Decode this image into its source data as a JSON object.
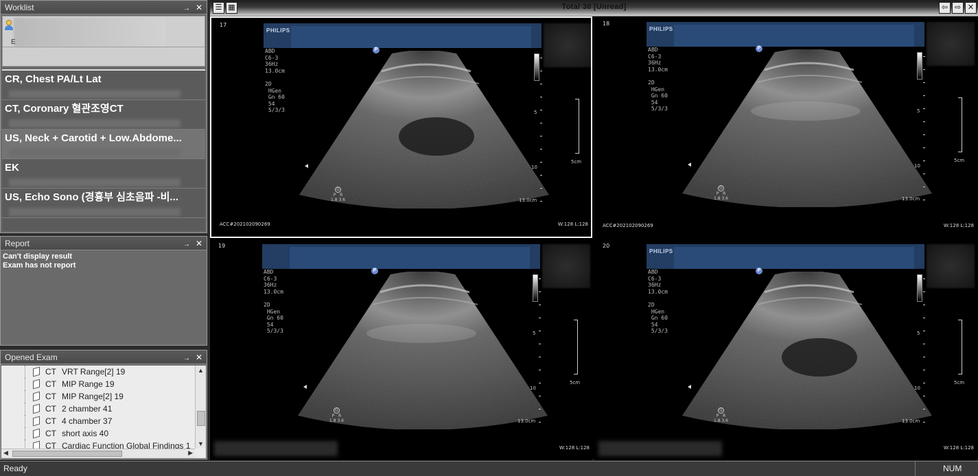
{
  "worklist": {
    "title": "Worklist",
    "patient_sub": "E",
    "exams": [
      {
        "title": "CR,  Chest PA/Lt Lat"
      },
      {
        "title": "CT,  Coronary  혈관조영CT"
      },
      {
        "title": "US,  Neck + Carotid + Low.Abdome..."
      },
      {
        "title": "EK"
      },
      {
        "title": "US,  Echo Sono (경흉부 심초음파 -비..."
      }
    ]
  },
  "panel_controls": {
    "pin": "→",
    "close": "✕"
  },
  "report": {
    "title": "Report",
    "lines": [
      "Can't display result",
      "Exam has not report"
    ]
  },
  "opened_exam": {
    "title": "Opened Exam",
    "rows": [
      {
        "mod": "CT",
        "name": "VRT Range[2] 19"
      },
      {
        "mod": "CT",
        "name": "MIP Range 19"
      },
      {
        "mod": "CT",
        "name": "MIP Range[2] 19"
      },
      {
        "mod": "CT",
        "name": "2 chamber 41"
      },
      {
        "mod": "CT",
        "name": "4 chamber 37"
      },
      {
        "mod": "CT",
        "name": "short axis 40"
      },
      {
        "mod": "CT",
        "name": "Cardiac Function Global Findings 1"
      }
    ]
  },
  "viewer": {
    "title": "Total 30  [Unread]",
    "cells": [
      {
        "frame": "17",
        "brand": "PHILIPS",
        "acc": "ACC#202102090269",
        "wl": "W:128 L:128"
      },
      {
        "frame": "18",
        "brand": "PHILIPS",
        "acc": "ACC#202102090269",
        "wl": "W:128 L:128"
      },
      {
        "frame": "19",
        "brand": "",
        "acc": "",
        "wl": "W:128 L:128"
      },
      {
        "frame": "20",
        "brand": "PHILIPS",
        "acc": "",
        "wl": "W:128 L:128"
      }
    ],
    "params": "ABD\nC6-3\n36Hz\n13.0cm\n\n2D\n HGen\n Gn 60\n 54\n 5/3/3",
    "probe_text": "P   R\n1.8 3.6",
    "depth": "13.0cm",
    "scale": "5cm",
    "mark5": "5",
    "mark10": "10"
  },
  "status": {
    "ready": "Ready",
    "num": "NUM"
  }
}
